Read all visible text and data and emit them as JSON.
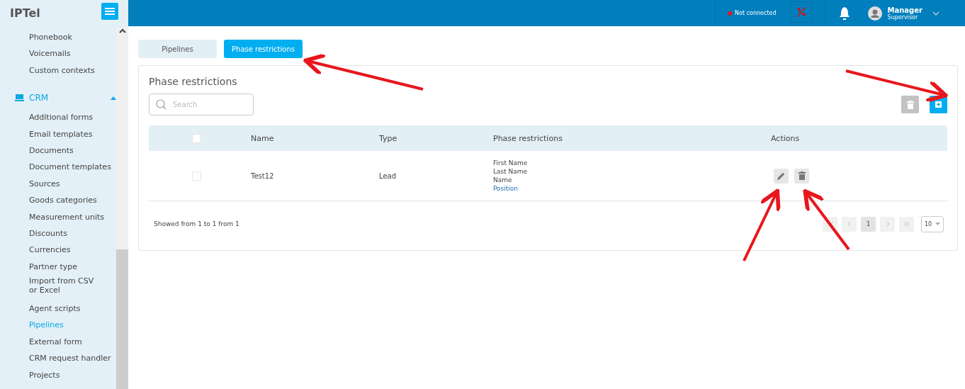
{
  "logo": "IPTel",
  "sidebar": {
    "items": [
      {
        "label": "Phonebook",
        "selected": false
      },
      {
        "label": "Voicemails",
        "selected": false
      },
      {
        "label": "Custom contexts",
        "selected": false
      }
    ],
    "section": {
      "label": "CRM",
      "expanded": true,
      "children": [
        {
          "label": "Additional forms",
          "selected": false
        },
        {
          "label": "Email templates",
          "selected": false
        },
        {
          "label": "Documents",
          "selected": false
        },
        {
          "label": "Document templates",
          "selected": false
        },
        {
          "label": "Sources",
          "selected": false
        },
        {
          "label": "Goods categories",
          "selected": false
        },
        {
          "label": "Measurement units",
          "selected": false
        },
        {
          "label": "Discounts",
          "selected": false
        },
        {
          "label": "Currencies",
          "selected": false
        },
        {
          "label": "Partner type",
          "selected": false
        },
        {
          "label": "Import from CSV or Excel",
          "selected": false
        },
        {
          "label": "Agent scripts",
          "selected": false
        },
        {
          "label": "Pipelines",
          "selected": true
        },
        {
          "label": "External form",
          "selected": false
        },
        {
          "label": "CRM request handler",
          "selected": false
        },
        {
          "label": "Projects",
          "selected": false
        }
      ]
    }
  },
  "topbar": {
    "status": "Not connected",
    "connected": false,
    "user": {
      "name": "Manager",
      "role": "Supervisor"
    }
  },
  "tabs": [
    {
      "label": "Pipelines",
      "selected": false
    },
    {
      "label": "Phase restrictions",
      "selected": true
    }
  ],
  "panel": {
    "title": "Phase restrictions",
    "search": {
      "placeholder": "Search"
    },
    "table": {
      "columns": [
        "Name",
        "Type",
        "Phase restrictions",
        "Actions"
      ],
      "header_checked": false,
      "rows": [
        {
          "checked": false,
          "name": "Test12",
          "type": "Lead",
          "phase_restrictions": [
            {
              "text": "First Name",
              "highlighted": false
            },
            {
              "text": "Last Name",
              "highlighted": false
            },
            {
              "text": "Name",
              "highlighted": false
            },
            {
              "text": "Position",
              "highlighted": true
            }
          ]
        }
      ]
    },
    "footer": "Showed from 1 to 1 from 1",
    "pages": [
      {
        "label": "1",
        "selected": true
      }
    ],
    "page_size": "10"
  }
}
